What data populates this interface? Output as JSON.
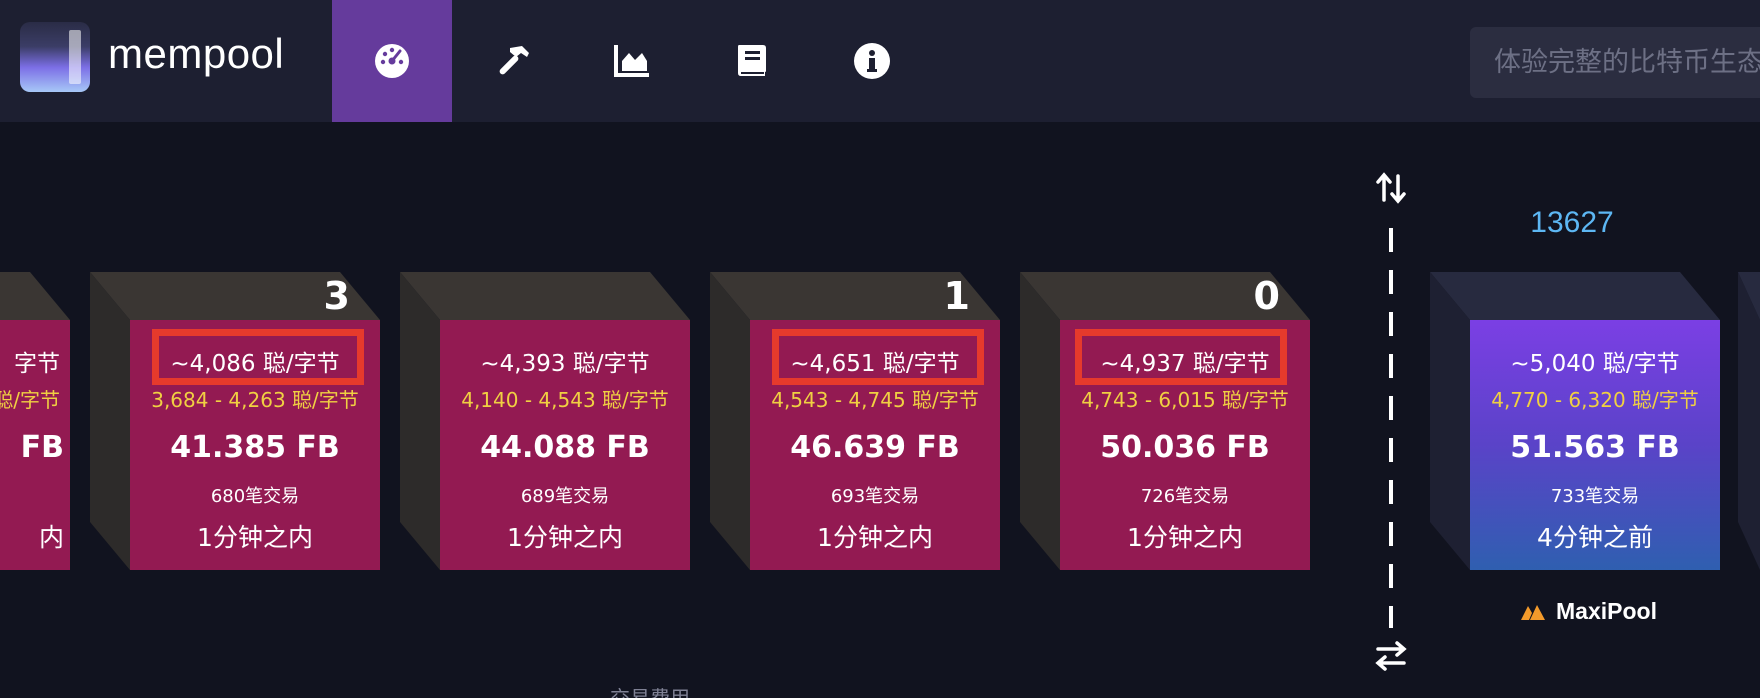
{
  "header": {
    "logo_text": "mempool",
    "search_placeholder": "体验完整的比特币生态",
    "nav": [
      {
        "name": "dashboard-icon",
        "active": true
      },
      {
        "name": "hammer-icon",
        "active": false
      },
      {
        "name": "chart-icon",
        "active": false
      },
      {
        "name": "book-icon",
        "active": false
      },
      {
        "name": "info-icon",
        "active": false
      }
    ]
  },
  "pending_blocks": [
    {
      "count": "",
      "median": "~? 聪/字节",
      "range": "",
      "size": "FB",
      "txs": "",
      "eta": "内"
    },
    {
      "count": "3",
      "median": "~4,086 聪/字节",
      "range": "3,684 - 4,263 聪/字节",
      "size": "41.385 FB",
      "txs": "680笔交易",
      "eta": "1分钟之内"
    },
    {
      "count": "",
      "median": "~4,393 聪/字节",
      "range": "4,140 - 4,543 聪/字节",
      "size": "44.088 FB",
      "txs": "689笔交易",
      "eta": "1分钟之内"
    },
    {
      "count": "1",
      "median": "~4,651 聪/字节",
      "range": "4,543 - 4,745 聪/字节",
      "size": "46.639 FB",
      "txs": "693笔交易",
      "eta": "1分钟之内"
    },
    {
      "count": "0",
      "median": "~4,937 聪/字节",
      "range": "4,743 - 6,015 聪/字节",
      "size": "50.036 FB",
      "txs": "726笔交易",
      "eta": "1分钟之内"
    }
  ],
  "first_partial": {
    "median": "字节",
    "range": "聪/字节",
    "size": "FB",
    "eta": "内"
  },
  "mined_block": {
    "height": "13627",
    "median": "~5,040 聪/字节",
    "range": "4,770 - 6,320 聪/字节",
    "size": "51.563 FB",
    "txs": "733笔交易",
    "eta": "4分钟之前",
    "pool": "MaxiPool"
  },
  "footer_label": "交易费用",
  "colors": {
    "pending_front": "#931a52",
    "highlight": "#e63a2c",
    "fee_range": "#f0d042",
    "block_height": "#5db7f3",
    "nav_active": "#653b9c"
  }
}
